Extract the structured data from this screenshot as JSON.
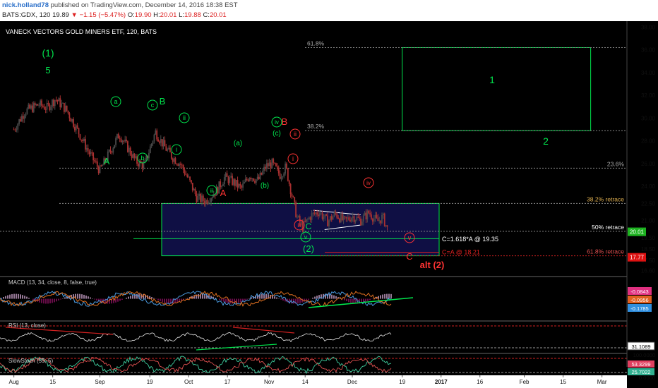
{
  "header": {
    "user": "nick.holland78",
    "published": "published on TradingView.com, December 14, 2016 18:38 EST",
    "symbol": "BATS:GDX, 120",
    "last": "19.89",
    "change": "▼ −1.15 (−5.47%)",
    "o_label": "O:",
    "o": "19.90",
    "h_label": "H:",
    "h": "20.01",
    "l_label": "L:",
    "l": "19.88",
    "c_label": "C:",
    "c": "20.01"
  },
  "chart_title": "VANECK VECTORS GOLD MINERS ETF, 120, BATS",
  "colors": {
    "bg": "#000000",
    "up": "#3a3a3a",
    "candle": "#aa3030",
    "green": "#00e64d",
    "red": "#ff3333",
    "white": "#ffffff",
    "box": "#0f0f44",
    "axis": "#d8d8d8"
  },
  "chart_data": {
    "type": "candlestick",
    "title": "VANECK VECTORS GOLD MINERS ETF, 120, BATS",
    "ylim": [
      16.2,
      38.4
    ],
    "y_ticks": [
      "38.00",
      "36.00",
      "34.00",
      "32.00",
      "30.00",
      "28.00",
      "26.00",
      "24.00",
      "22.50",
      "21.00",
      "19.50",
      "18.50",
      "17.50",
      "16.60"
    ],
    "y_tick_values": [
      38,
      36,
      34,
      32,
      30,
      28,
      26,
      24,
      22.5,
      21,
      19.5,
      18.5,
      17.5,
      16.6
    ],
    "x_ticks": [
      "Aug",
      "15",
      "Sep",
      "19",
      "Oct",
      "17",
      "Nov",
      "14",
      "Dec",
      "19",
      "2017",
      "16",
      "Feb",
      "15",
      "Mar"
    ],
    "x_tick_dates": [
      "2016-08-01",
      "2016-08-15",
      "2016-09-01",
      "2016-09-19",
      "2016-10-03",
      "2016-10-17",
      "2016-11-01",
      "2016-11-14",
      "2016-12-01",
      "2016-12-19",
      "2017-01-02",
      "2017-01-16",
      "2017-02-01",
      "2017-02-15",
      "2017-03-01"
    ],
    "price_path": [
      [
        "2016-08-01",
        29.0
      ],
      [
        "2016-08-05",
        30.6
      ],
      [
        "2016-08-10",
        31.2
      ],
      [
        "2016-08-13",
        30.9
      ],
      [
        "2016-08-16",
        31.7
      ],
      [
        "2016-08-20",
        30.7
      ],
      [
        "2016-08-24",
        28.9
      ],
      [
        "2016-08-28",
        27.0
      ],
      [
        "2016-09-01",
        25.4
      ],
      [
        "2016-09-05",
        27.2
      ],
      [
        "2016-09-08",
        28.6
      ],
      [
        "2016-09-11",
        27.4
      ],
      [
        "2016-09-14",
        26.2
      ],
      [
        "2016-09-17",
        25.8
      ],
      [
        "2016-09-21",
        28.8
      ],
      [
        "2016-09-24",
        27.6
      ],
      [
        "2016-09-27",
        26.6
      ],
      [
        "2016-09-30",
        26.0
      ],
      [
        "2016-10-03",
        24.6
      ],
      [
        "2016-10-06",
        23.0
      ],
      [
        "2016-10-09",
        22.7
      ],
      [
        "2016-10-13",
        23.6
      ],
      [
        "2016-10-16",
        24.8
      ],
      [
        "2016-10-19",
        24.4
      ],
      [
        "2016-10-22",
        23.8
      ],
      [
        "2016-10-25",
        25.0
      ],
      [
        "2016-10-28",
        24.5
      ],
      [
        "2016-10-31",
        25.8
      ],
      [
        "2016-11-02",
        26.0
      ],
      [
        "2016-11-05",
        25.0
      ],
      [
        "2016-11-07",
        25.7
      ],
      [
        "2016-11-09",
        23.5
      ],
      [
        "2016-11-11",
        21.3
      ],
      [
        "2016-11-13",
        20.4
      ],
      [
        "2016-11-16",
        21.4
      ],
      [
        "2016-11-19",
        21.8
      ],
      [
        "2016-11-22",
        20.9
      ],
      [
        "2016-11-25",
        21.6
      ],
      [
        "2016-11-28",
        20.9
      ],
      [
        "2016-12-01",
        21.4
      ],
      [
        "2016-12-04",
        21.0
      ],
      [
        "2016-12-07",
        21.7
      ],
      [
        "2016-12-10",
        20.9
      ],
      [
        "2016-12-12",
        21.3
      ],
      [
        "2016-12-14",
        20.0
      ]
    ],
    "last_price": "20.01",
    "levels": [
      {
        "name": "38.2% retrace",
        "value": 22.5
      },
      {
        "name": "50% retrace",
        "value": 20.05
      },
      {
        "name": "61.8% retrace",
        "value": 17.9
      },
      {
        "name": "23.6%",
        "value": 25.6
      },
      {
        "name": "61.8%",
        "value": 36.2
      },
      {
        "name": "38.2%",
        "value": 28.9
      }
    ],
    "targets": [
      {
        "label": "C=1.618*A @ 19.35",
        "value": 19.35
      },
      {
        "label": "C=A @ 18.21",
        "value": 18.21
      }
    ],
    "wave_labels": {
      "green": [
        "(1)",
        "5",
        "A",
        "a",
        "b",
        "c",
        "B",
        "i",
        "ii",
        "iii",
        "iv",
        "(c)",
        "(a)",
        "(b)",
        "C",
        "v",
        "(2)",
        "1",
        "2"
      ],
      "red": [
        "B",
        "ii",
        "i",
        "iv",
        "iii",
        "A",
        "v",
        "C",
        "alt (2)"
      ]
    },
    "projection_box": {
      "date_from": "2016-12-19",
      "date_to": "2017-03-01",
      "y_from": 28.9,
      "y_to": 36.2,
      "label": "1"
    },
    "scale_tags": [
      "20.01",
      "17.77"
    ]
  },
  "indicators": {
    "macd": {
      "label": "MACD (13, 34, close, 8, false, true)",
      "values": [
        "-0.0843",
        "-0.0956",
        "-0.1785"
      ]
    },
    "rsi": {
      "label": "RSI (13, close)",
      "value": "31.1089"
    },
    "stoch": {
      "label": "SlowStoch (55, 5)",
      "ticks": [
        "100.0000",
        "0.0000"
      ],
      "values": [
        "53.3299",
        "25.7022"
      ]
    }
  }
}
